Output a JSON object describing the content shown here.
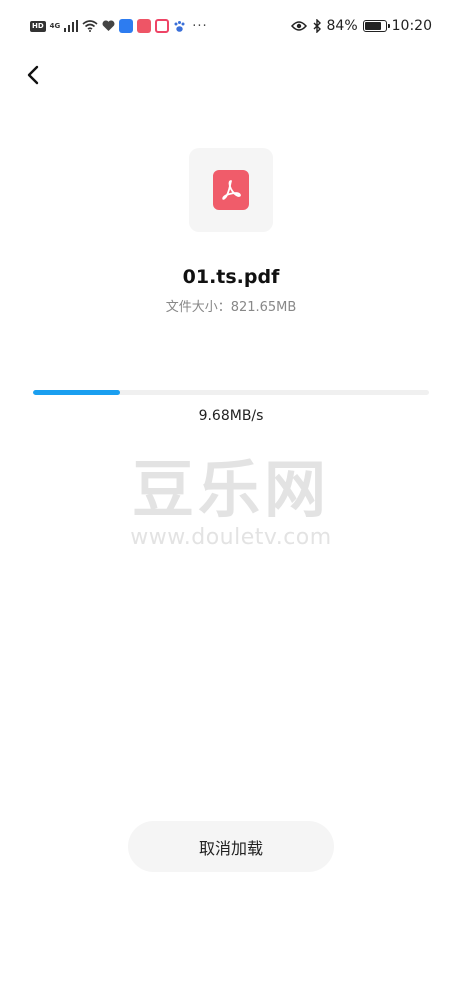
{
  "status_bar": {
    "hd": "HD",
    "network": "4G",
    "battery_percent": "84%",
    "battery_level": 0.84,
    "time": "10:20",
    "more": "···"
  },
  "file": {
    "name": "01.ts.pdf",
    "size_text": "文件大小：821.65MB",
    "icon": "pdf-icon"
  },
  "download": {
    "progress": 0.22,
    "speed": "9.68MB/s"
  },
  "watermark": {
    "main": "豆乐网",
    "sub": "www.douletv.com"
  },
  "actions": {
    "cancel_label": "取消加载"
  },
  "colors": {
    "accent": "#1a9ff0",
    "pdf_red": "#f05c6a"
  }
}
